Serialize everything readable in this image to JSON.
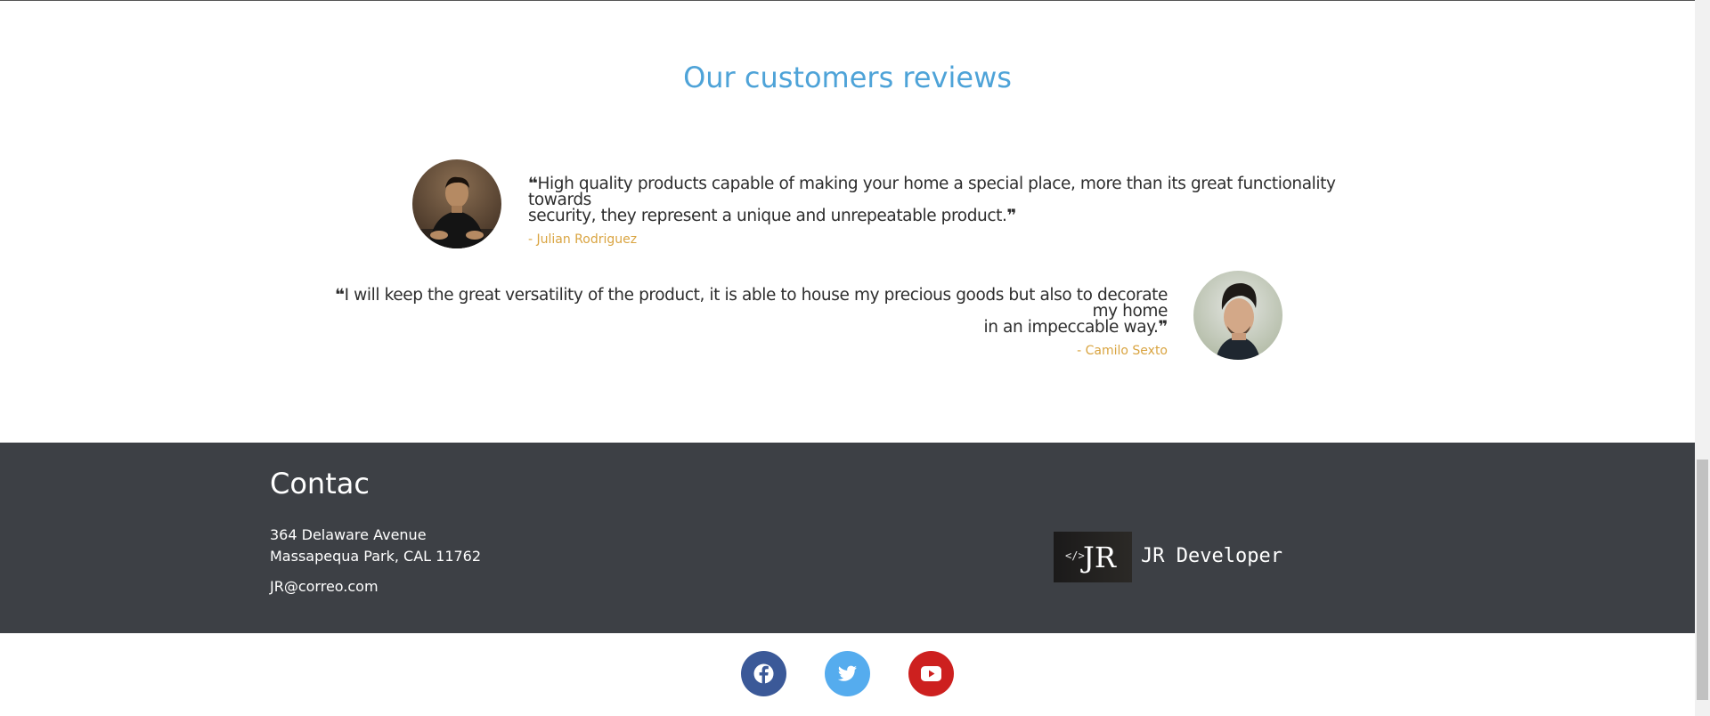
{
  "reviews": {
    "title": "Our customers reviews",
    "items": [
      {
        "open_mark": "❝",
        "text": "High quality products capable of making your home a special place, more than its great functionality towards security, they represent a unique and unrepeatable product.",
        "line1": "High quality products capable of making your home a special place, more than its great functionality towards",
        "line2": "security, they represent a unique and unrepeatable product.",
        "close_mark": "❞",
        "author": "- Julian Rodriguez"
      },
      {
        "open_mark": "❝",
        "line1": "I will keep the great versatility of the product, it is able to house my precious goods but also to decorate my home",
        "line2": "in an impeccable way.",
        "close_mark": "❞",
        "author": "- Camilo Sexto"
      }
    ]
  },
  "footer": {
    "contact_title": "Contac",
    "address_line1": "364 Delaware Avenue",
    "address_line2": "Massapequa Park, CAL 11762",
    "email": "JR@correo.com",
    "brand": {
      "logo_code": "</>",
      "logo_initials": "JR",
      "name": "JR Developer"
    }
  },
  "social": [
    {
      "name": "facebook",
      "icon": "facebook-icon",
      "color": "#3b5998"
    },
    {
      "name": "twitter",
      "icon": "twitter-icon",
      "color": "#55acee"
    },
    {
      "name": "youtube",
      "icon": "youtube-icon",
      "color": "#cd201f"
    }
  ],
  "colors": {
    "title": "#4ea3d8",
    "author": "#d9a441",
    "footer_bg": "#3d4045"
  }
}
